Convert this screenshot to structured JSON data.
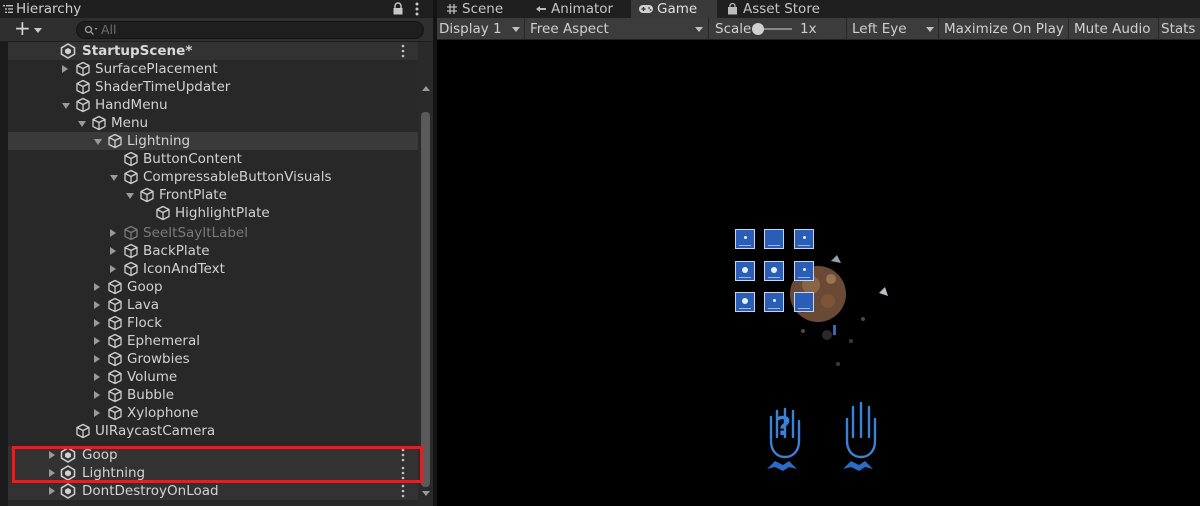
{
  "hierarchy": {
    "title": "Hierarchy",
    "search_placeholder": "All",
    "scene_name": "StartupScene*",
    "rows": [
      {
        "label": "SurfacePlacement"
      },
      {
        "label": "ShaderTimeUpdater"
      },
      {
        "label": "HandMenu"
      },
      {
        "label": "Menu"
      },
      {
        "label": "Lightning"
      },
      {
        "label": "ButtonContent"
      },
      {
        "label": "CompressableButtonVisuals"
      },
      {
        "label": "FrontPlate"
      },
      {
        "label": "HighlightPlate"
      },
      {
        "label": "SeeItSayItLabel"
      },
      {
        "label": "BackPlate"
      },
      {
        "label": "IconAndText"
      },
      {
        "label": "Goop"
      },
      {
        "label": "Lava"
      },
      {
        "label": "Flock"
      },
      {
        "label": "Ephemeral"
      },
      {
        "label": "Growbies"
      },
      {
        "label": "Volume"
      },
      {
        "label": "Bubble"
      },
      {
        "label": "Xylophone"
      },
      {
        "label": "UIRaycastCamera"
      }
    ],
    "extra_scenes": [
      {
        "label": "Goop"
      },
      {
        "label": "Lightning"
      },
      {
        "label": "DontDestroyOnLoad"
      }
    ]
  },
  "tabs": {
    "scene": "Scene",
    "animator": "Animator",
    "game": "Game",
    "asset_store": "Asset Store"
  },
  "game_toolbar": {
    "display": "Display 1",
    "aspect": "Free Aspect",
    "scale_label": "Scale",
    "scale_value": "1x",
    "eye": "Left Eye",
    "maximize": "Maximize On Play",
    "mute": "Mute Audio",
    "stats": "Stats"
  },
  "colors": {
    "highlight_box": "#d0262c",
    "menu_tile": "#2a5db5",
    "hand_icon": "#3b82d6"
  },
  "icons": [
    "hierarchy-icon",
    "lock-icon",
    "kebab-menu-icon",
    "plus-icon",
    "search-icon",
    "unity-scene-icon",
    "gameobject-cube-icon",
    "scene-hash-icon",
    "animator-icon",
    "gamepad-icon",
    "shopping-bag-icon",
    "help-hand-icon",
    "open-hand-icon"
  ]
}
